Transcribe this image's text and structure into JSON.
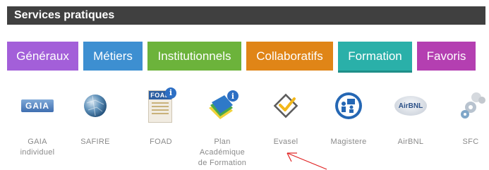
{
  "header": {
    "title": "Services pratiques"
  },
  "tabs": [
    {
      "label": "Généraux",
      "color": "#a35fd9"
    },
    {
      "label": "Métiers",
      "color": "#3d8fd1"
    },
    {
      "label": "Institutionnels",
      "color": "#6cb33b"
    },
    {
      "label": "Collaboratifs",
      "color": "#e08517"
    },
    {
      "label": "Formation",
      "color": "#2ab0a9",
      "active": true
    },
    {
      "label": "Favoris",
      "color": "#b43fb1"
    }
  ],
  "apps": [
    {
      "label": "GAIA individuel",
      "icon": "gaia-logo-icon",
      "logo_text": "GAIA"
    },
    {
      "label": "SAFIRE",
      "icon": "globe-icon"
    },
    {
      "label": "FOAD",
      "icon": "foad-document-icon",
      "logo_text": "FOAD"
    },
    {
      "label": "Plan Académique de Formation",
      "icon": "books-info-icon"
    },
    {
      "label": "Evasel",
      "icon": "checkmark-diamond-icon"
    },
    {
      "label": "Magistere",
      "icon": "classroom-icon"
    },
    {
      "label": "AirBNL",
      "icon": "airbnl-cloud-icon",
      "logo_text": "AirBNL"
    },
    {
      "label": "SFC",
      "icon": "gears-icon"
    }
  ]
}
